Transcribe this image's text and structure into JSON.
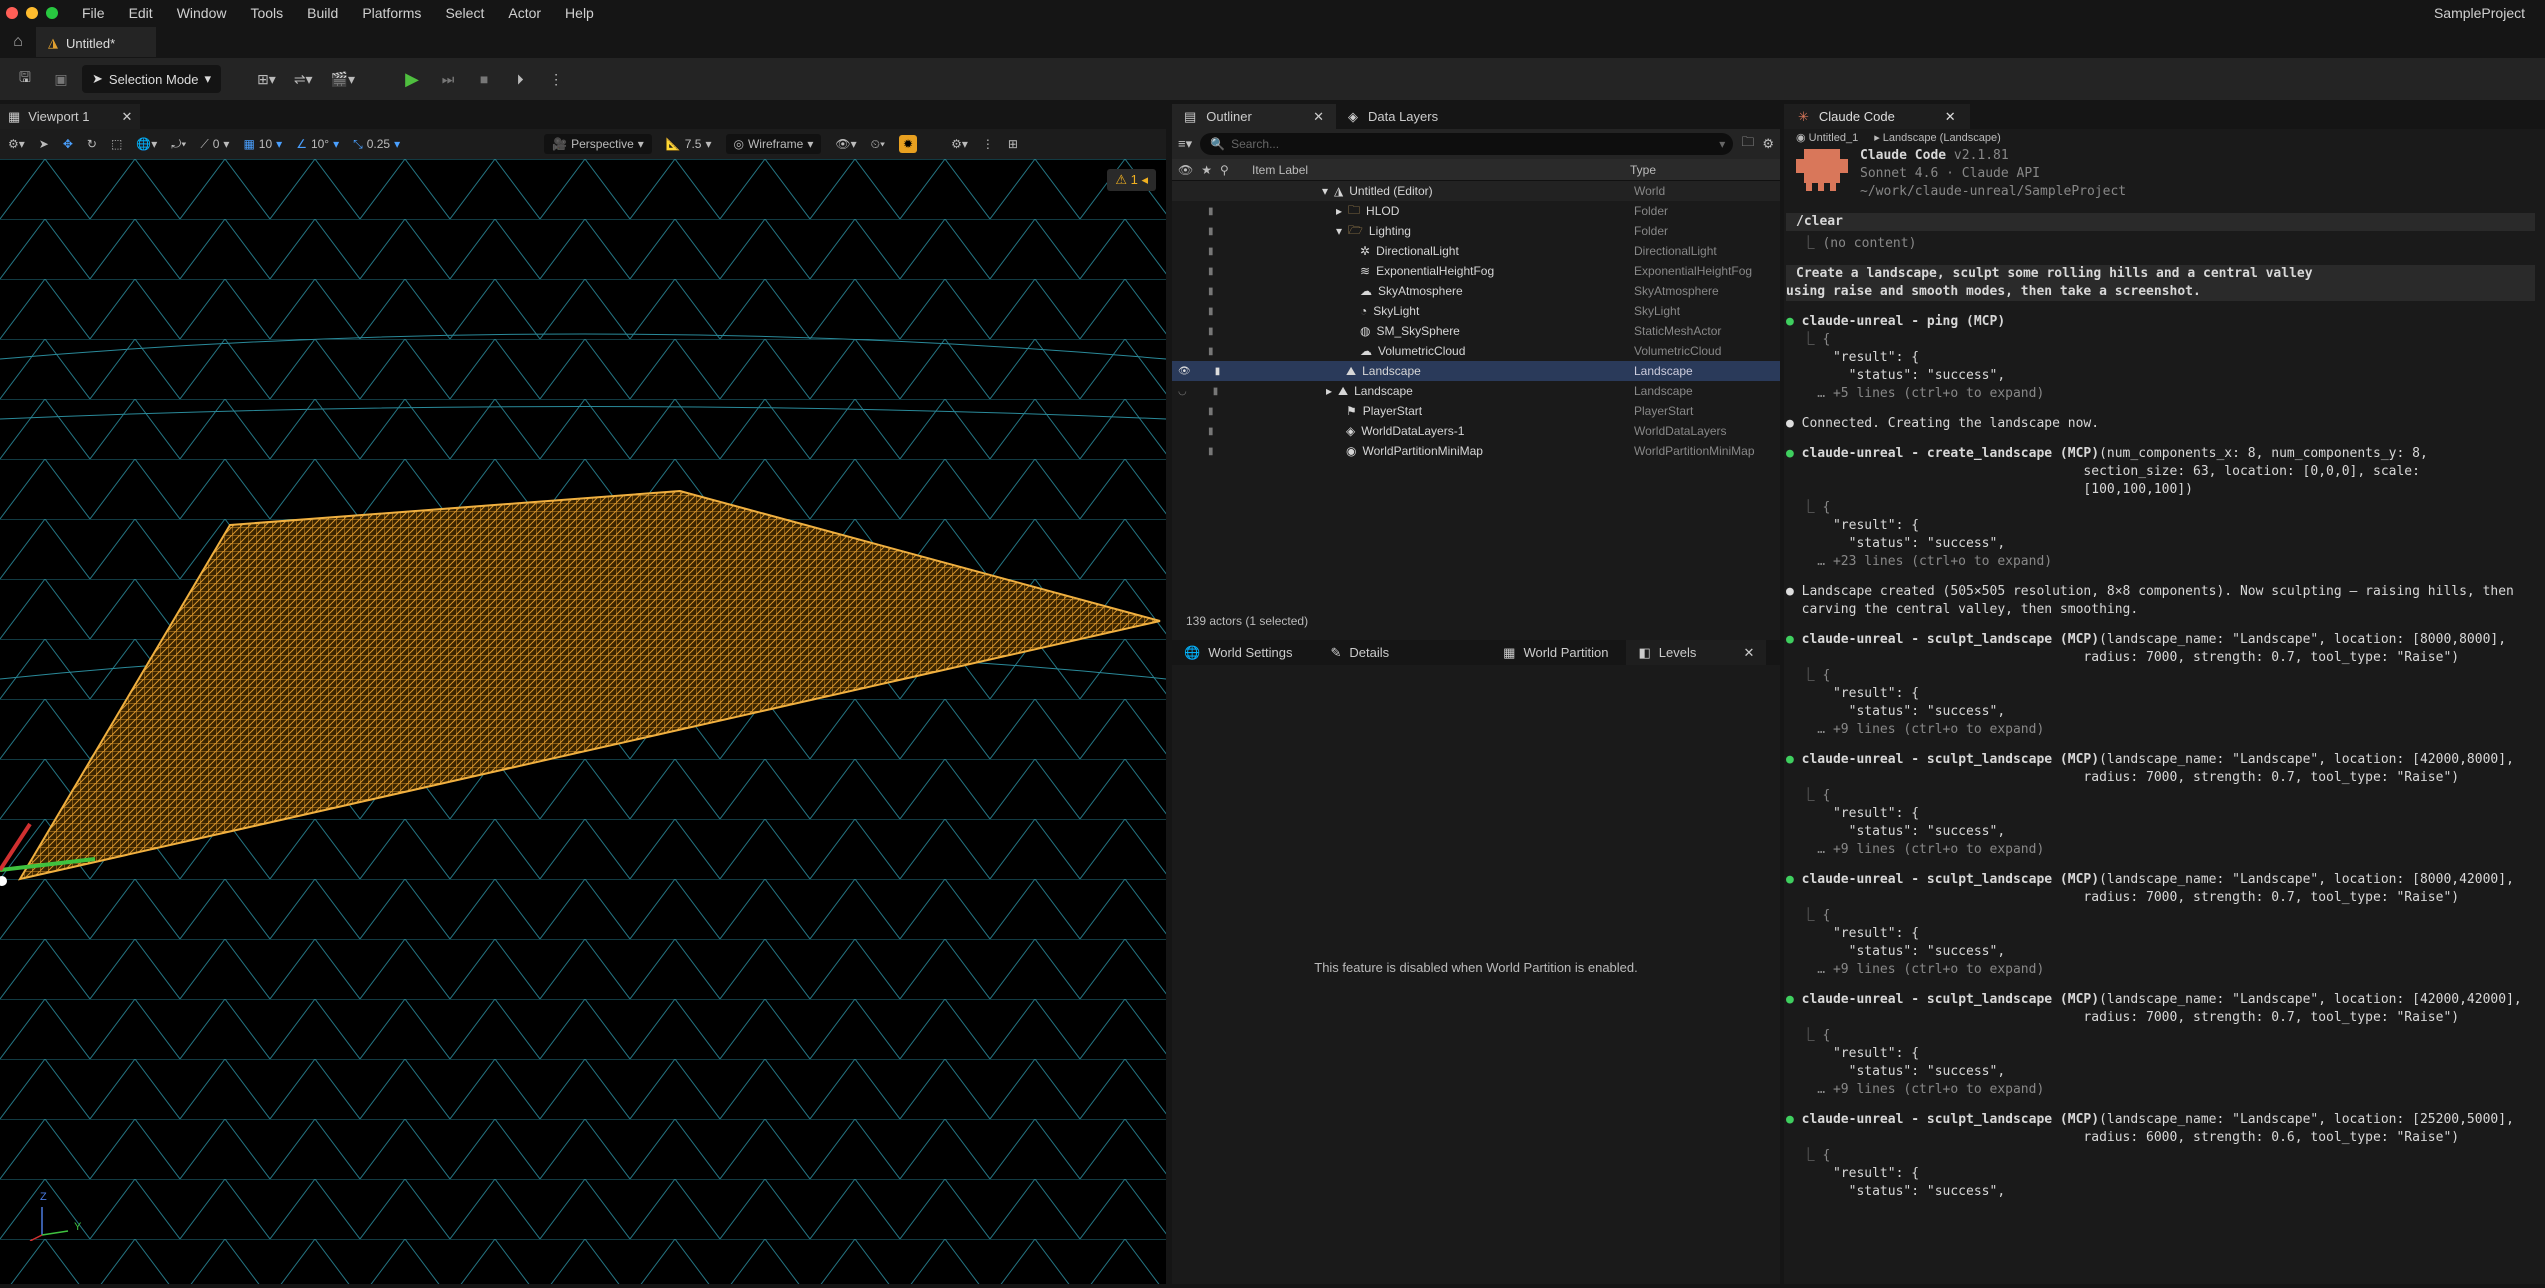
{
  "menubar": {
    "items": [
      "File",
      "Edit",
      "Window",
      "Tools",
      "Build",
      "Platforms",
      "Select",
      "Actor",
      "Help"
    ],
    "project": "SampleProject"
  },
  "document_tab": {
    "title": "Untitled*"
  },
  "toolbar": {
    "selection_mode": "Selection Mode"
  },
  "viewport": {
    "tab": "Viewport 1",
    "rotate_snap": "0",
    "grid_snap": "10",
    "angle_snap": "10°",
    "scale_snap": "0.25",
    "view": "Perspective",
    "fov": "7.5",
    "view_mode": "Wireframe",
    "warning_count": "1",
    "axis_z": "Z",
    "axis_y": "Y"
  },
  "outliner": {
    "tab": "Outliner",
    "tab2": "Data Layers",
    "search_placeholder": "Search...",
    "col_label": "Item Label",
    "col_type": "Type",
    "rows": [
      {
        "label": "Untitled (Editor)",
        "type": "World"
      },
      {
        "label": "HLOD",
        "type": "Folder"
      },
      {
        "label": "Lighting",
        "type": "Folder"
      },
      {
        "label": "DirectionalLight",
        "type": "DirectionalLight"
      },
      {
        "label": "ExponentialHeightFog",
        "type": "ExponentialHeightFog"
      },
      {
        "label": "SkyAtmosphere",
        "type": "SkyAtmosphere"
      },
      {
        "label": "SkyLight",
        "type": "SkyLight"
      },
      {
        "label": "SM_SkySphere",
        "type": "StaticMeshActor"
      },
      {
        "label": "VolumetricCloud",
        "type": "VolumetricCloud"
      },
      {
        "label": "Landscape",
        "type": "Landscape"
      },
      {
        "label": "Landscape",
        "type": "Landscape"
      },
      {
        "label": "PlayerStart",
        "type": "PlayerStart"
      },
      {
        "label": "WorldDataLayers-1",
        "type": "WorldDataLayers"
      },
      {
        "label": "WorldPartitionMiniMap",
        "type": "WorldPartitionMiniMap"
      }
    ],
    "count": "139 actors (1 selected)"
  },
  "bottom_tabs": [
    "World Settings",
    "Details",
    "World Partition",
    "Levels"
  ],
  "disabled_msg": "This feature is disabled when World Partition is enabled.",
  "claude": {
    "tab": "Claude Code",
    "crumb1": "Untitled_1",
    "crumb2": "Landscape (Landscape)",
    "title": "Claude Code",
    "version": "v2.1.81",
    "model": "Sonnet 4.6 · Claude API",
    "path": "~/work/claude-unreal/SampleProject",
    "lines": {
      "clear": "/clear",
      "nocontent": "  ⎿ (no content)",
      "p1": "Create a landscape, sculpt some rolling hills and a central valley",
      "p2": "using raise and smooth modes, then take a screenshot.",
      "ping": "claude-unreal - ping (MCP)",
      "br": "  ⎿ {",
      "res": "      \"result\": {",
      "st": "        \"status\": \"success\",",
      "e5": "    … +5 lines (ctrl+o to expand)",
      "conn": "Connected. Creating the landscape now.",
      "cl_a": "claude-unreal - create_landscape (MCP)",
      "cl_b": "(num_components_x: 8, num_components_y: 8,",
      "cl_c": "                                      section_size: 63, location: [0,0,0], scale:",
      "cl_d": "                                      [100,100,100])",
      "e23": "    … +23 lines (ctrl+o to expand)",
      "lc1": "Landscape created (505×505 resolution, 8×8 components). Now sculpting — raising hills, then",
      "lc2": "  carving the central valley, then smoothing.",
      "s_a": "claude-unreal - sculpt_landscape (MCP)",
      "s1_b": "(landscape_name: \"Landscape\", location: [8000,8000],",
      "s2_b": "(landscape_name: \"Landscape\", location: [42000,8000],",
      "s3_b": "(landscape_name: \"Landscape\", location: [8000,42000],",
      "s4_b": "(landscape_name: \"Landscape\", location: [42000,42000],",
      "s5_b": "(landscape_name: \"Landscape\", location: [25200,5000],",
      "s_c": "                                      radius: 7000, strength: 0.7, tool_type: \"Raise\")",
      "s5_c": "                                      radius: 6000, strength: 0.6, tool_type: \"Raise\")",
      "e9": "    … +9 lines (ctrl+o to expand)"
    }
  }
}
